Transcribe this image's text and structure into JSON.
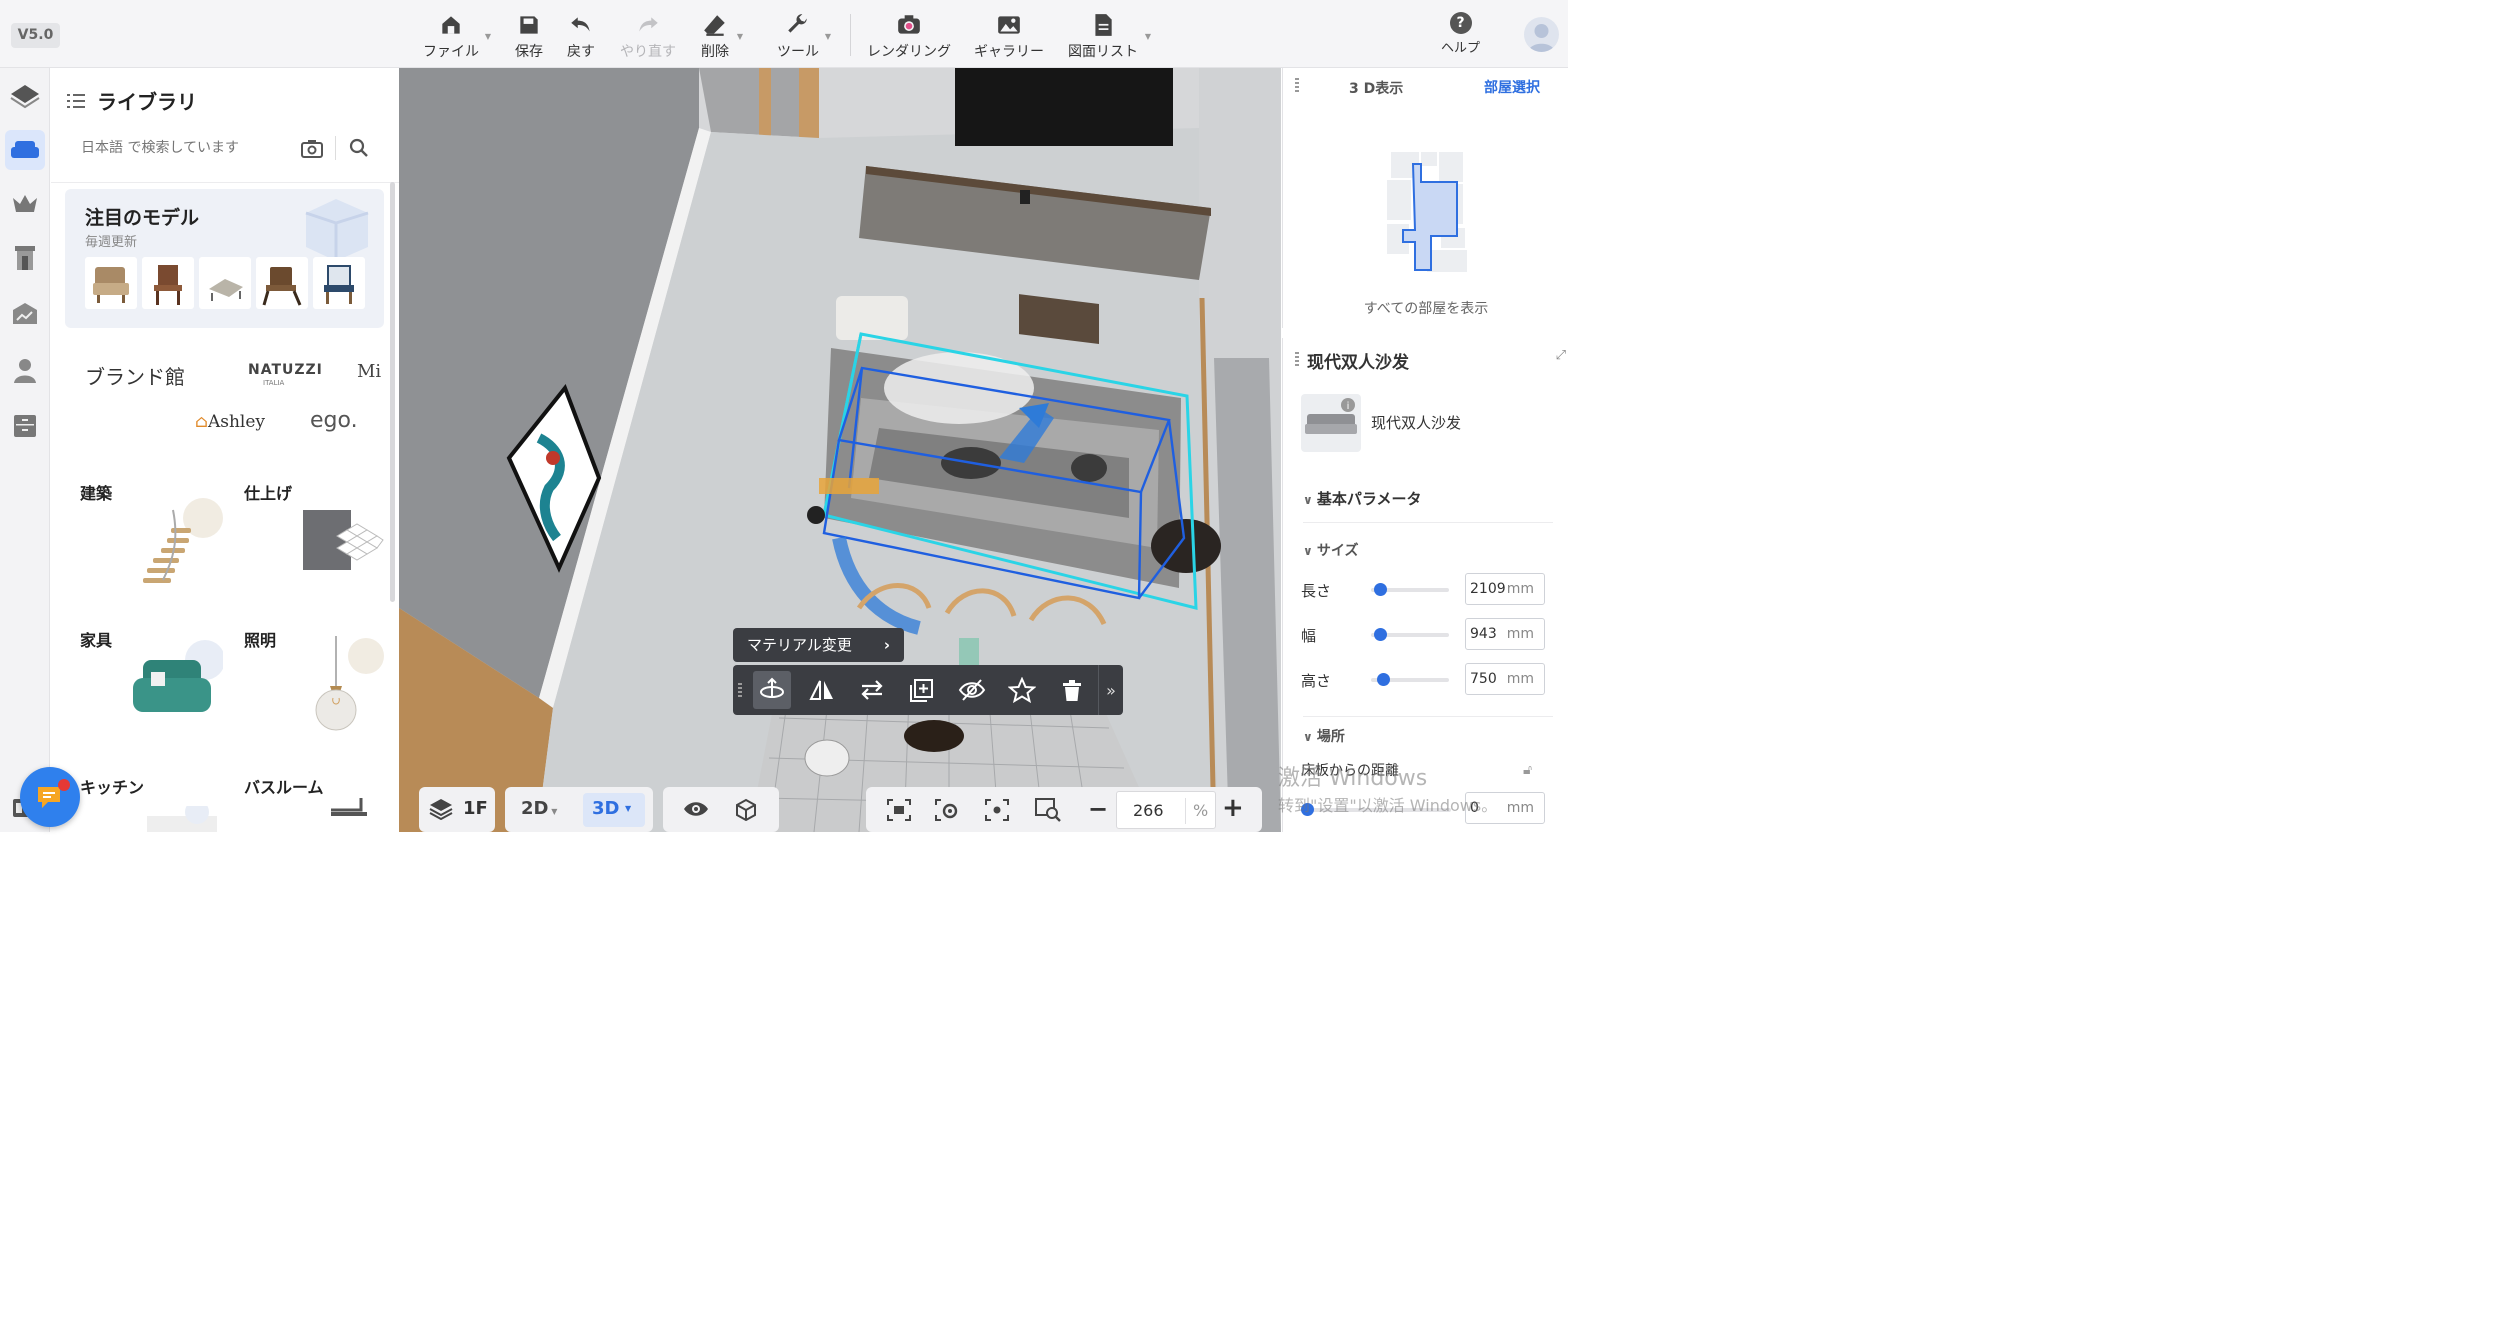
{
  "version": "V5.0",
  "toolbar": {
    "items": [
      {
        "label": "ファイル",
        "icon": "home-file-icon",
        "has_caret": true,
        "enabled": true
      },
      {
        "label": "保存",
        "icon": "save-icon",
        "enabled": true
      },
      {
        "label": "戻す",
        "icon": "undo-icon",
        "enabled": true
      },
      {
        "label": "やり直す",
        "icon": "redo-icon",
        "enabled": false
      },
      {
        "label": "削除",
        "icon": "eraser-icon",
        "has_caret": true,
        "enabled": true
      },
      {
        "label": "ツール",
        "icon": "wrench-icon",
        "has_caret": true,
        "enabled": true
      },
      {
        "label": "レンダリング",
        "icon": "camera-render-icon",
        "enabled": true
      },
      {
        "label": "ギャラリー",
        "icon": "gallery-icon",
        "enabled": true
      },
      {
        "label": "図面リスト",
        "icon": "document-list-icon",
        "has_caret": true,
        "enabled": true
      }
    ],
    "help_label": "ヘルプ"
  },
  "library": {
    "title": "ライブラリ",
    "search_placeholder": "日本語 で検索しています",
    "featured": {
      "title": "注目のモデル",
      "subtitle": "毎週更新"
    },
    "brand_title": "ブランド館",
    "brands": [
      "NATUZZI",
      "ITALIA",
      "Mi",
      "Ashley",
      "ego."
    ],
    "categories": [
      "建築",
      "仕上げ",
      "家具",
      "照明",
      "キッチン",
      "バスルーム"
    ]
  },
  "context_toolbar": {
    "material_button": "マテリアル変更",
    "tools": [
      "rotate-icon",
      "mirror-icon",
      "swap-icon",
      "duplicate-icon",
      "hide-icon",
      "favorite-star-icon",
      "delete-trash-icon",
      "more-chevron-icon"
    ]
  },
  "right_panel": {
    "view_title": "3 D表示",
    "room_select": "部屋選択",
    "show_all_rooms": "すべての部屋を表示",
    "object_title": "现代双人沙发",
    "object_name": "现代双人沙发",
    "basic_params": "基本パラメータ",
    "size_section": "サイズ",
    "params": [
      {
        "label": "長さ",
        "value": "2109",
        "unit": "mm",
        "level": 0.12
      },
      {
        "label": "幅",
        "value": "943",
        "unit": "mm",
        "level": 0.12
      },
      {
        "label": "高さ",
        "value": "750",
        "unit": "mm",
        "level": 0.15
      }
    ],
    "place_section": "場所",
    "floor_distance_label": "床板からの距離",
    "floor_distance_value": "0",
    "floor_distance_unit": "mm"
  },
  "watermark": {
    "line1": "激活 Windows",
    "line2": "转到\"设置\"以激活 Windows。"
  },
  "bottom_bar": {
    "floor": "1F",
    "mode_2d": "2D",
    "mode_3d": "3D",
    "zoom_value": "266",
    "zoom_unit": "%"
  },
  "colors": {
    "accent": "#2f6fe0",
    "selection": "#2ad4e6",
    "box": "#1f5fe0"
  }
}
